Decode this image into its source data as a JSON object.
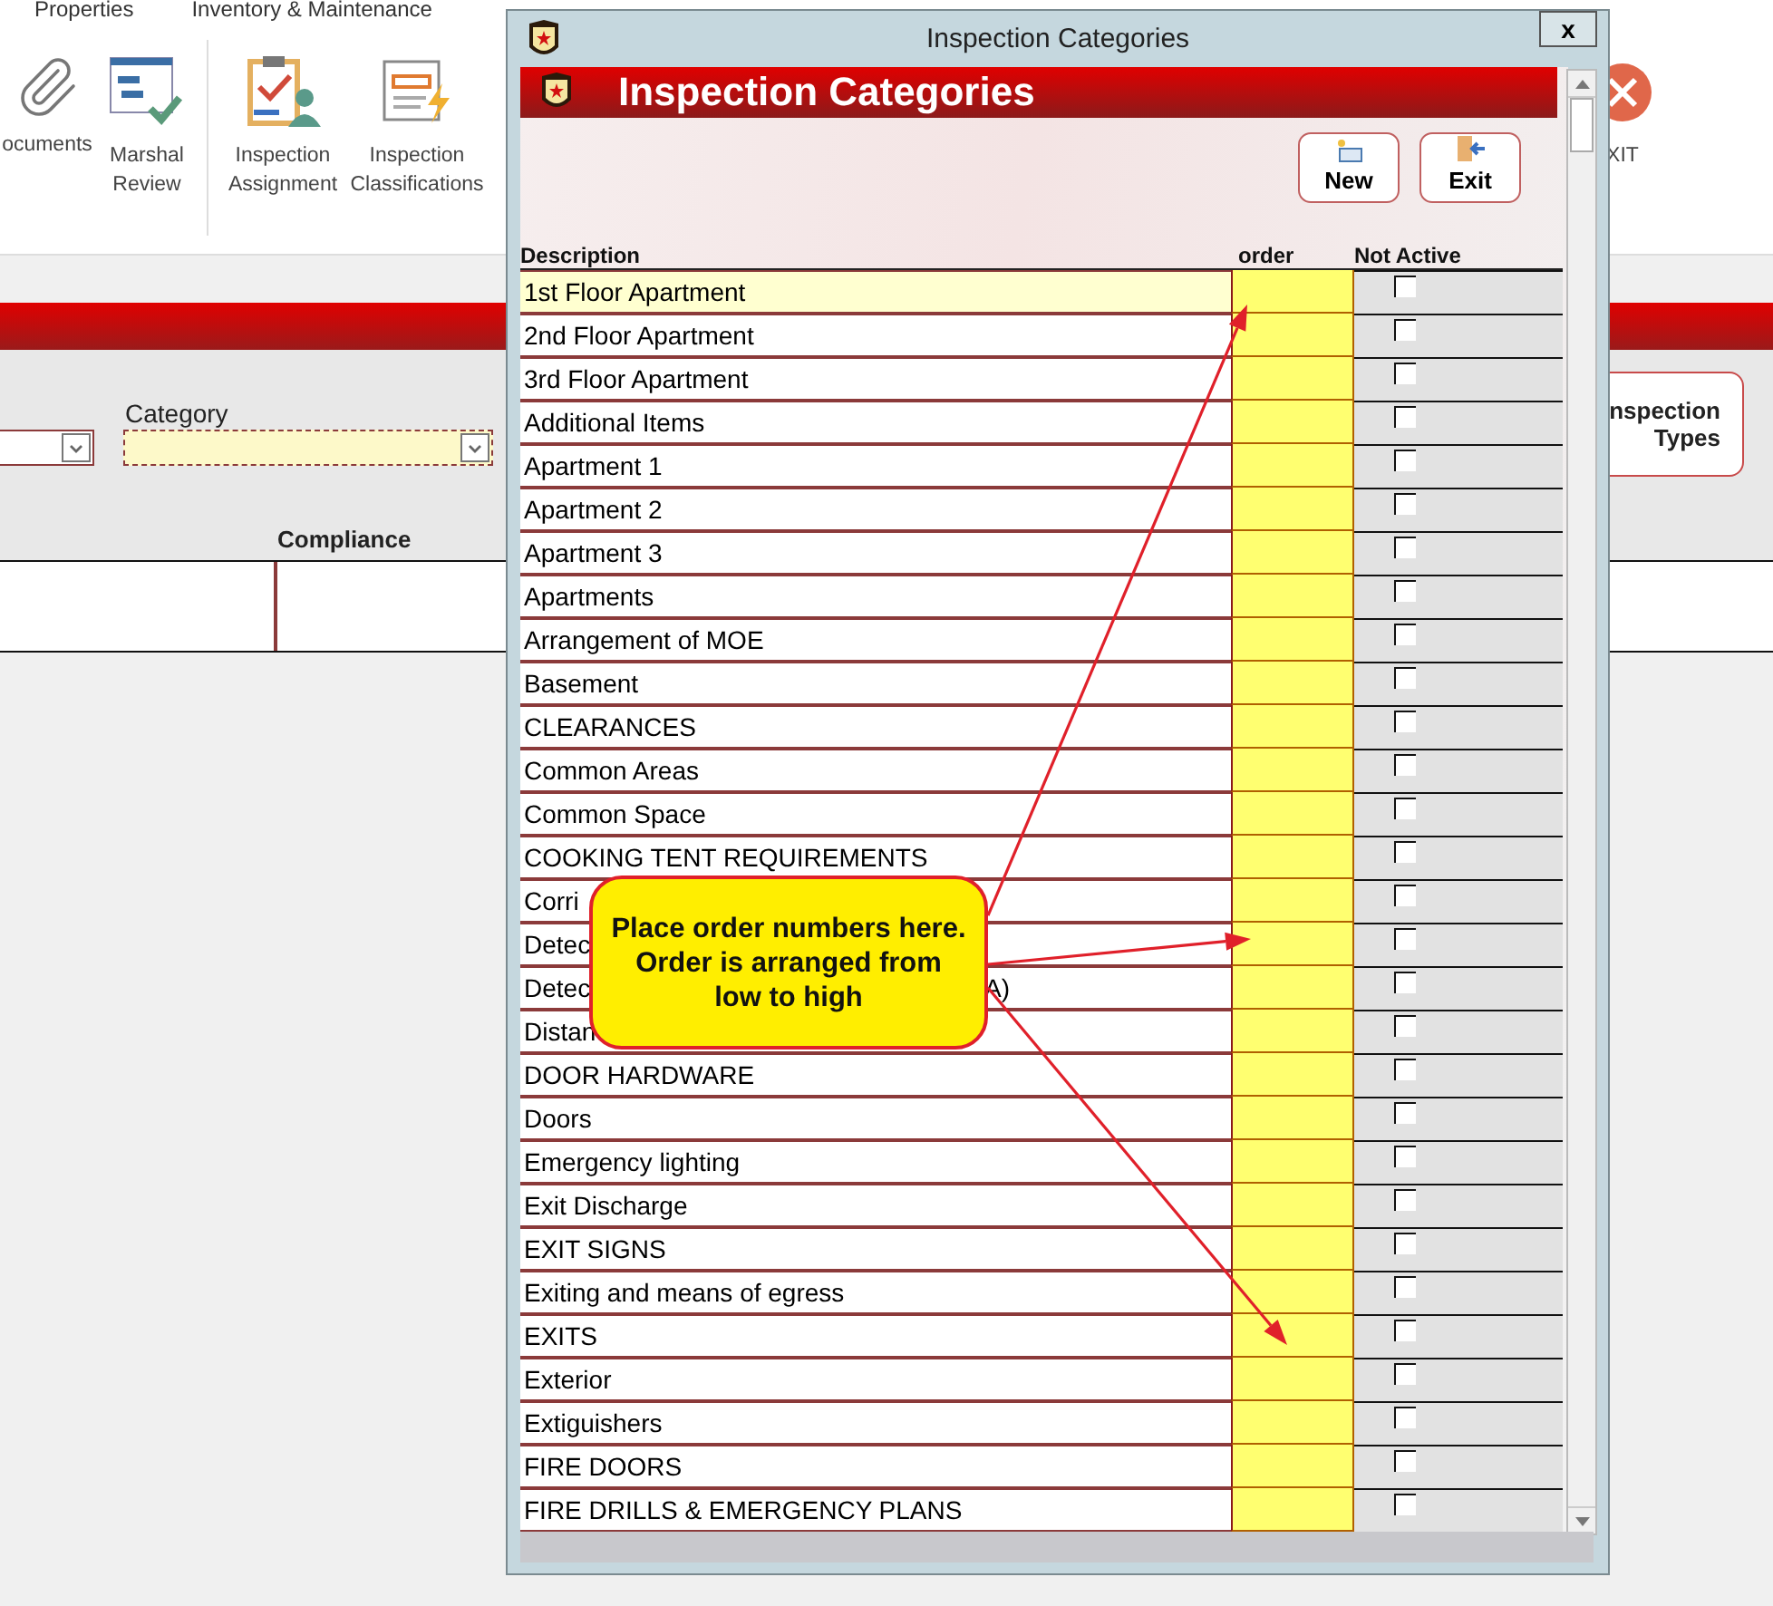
{
  "app": {
    "tabs": [
      "Properties",
      "Inventory & Maintenance"
    ],
    "ribbon": [
      {
        "kind": "clip",
        "label": "ocuments"
      },
      {
        "kind": "grid",
        "label": "Marshal Review"
      },
      {
        "kind": "clipboard",
        "label": "Inspection Assignment"
      },
      {
        "kind": "bolt",
        "label": "Inspection Classifications"
      }
    ],
    "exit_label": "XIT",
    "category_label": "Category",
    "types_button": "nspection Types",
    "column": "Compliance"
  },
  "dialog": {
    "title": "Inspection Categories",
    "close": "x",
    "banner": "Inspection Categories",
    "buttons": [
      {
        "kind": "new",
        "label": "New"
      },
      {
        "kind": "exit",
        "label": "Exit"
      }
    ],
    "columns": [
      "Description",
      "order",
      "Not Active"
    ],
    "rows": [
      {
        "text": "1st Floor Apartment",
        "selected": true,
        "not_active": false
      },
      {
        "text": "2nd Floor Apartment",
        "selected": false,
        "not_active": false
      },
      {
        "text": "3rd Floor Apartment",
        "selected": false,
        "not_active": false
      },
      {
        "text": "Additional Items",
        "selected": false,
        "not_active": false
      },
      {
        "text": "Apartment 1",
        "selected": false,
        "not_active": false
      },
      {
        "text": "Apartment 2",
        "selected": false,
        "not_active": false
      },
      {
        "text": "Apartment 3",
        "selected": false,
        "not_active": false
      },
      {
        "text": "Apartments",
        "selected": false,
        "not_active": false
      },
      {
        "text": "Arrangement of MOE",
        "selected": false,
        "not_active": false
      },
      {
        "text": "Basement",
        "selected": false,
        "not_active": false
      },
      {
        "text": "CLEARANCES",
        "selected": false,
        "not_active": false
      },
      {
        "text": "Common Areas",
        "selected": false,
        "not_active": false
      },
      {
        "text": "Common Space",
        "selected": false,
        "not_active": false
      },
      {
        "text": "COOKING TENT REQUIREMENTS",
        "selected": false,
        "not_active": false
      },
      {
        "text": "Corri",
        "selected": false,
        "not_active": false
      },
      {
        "text": "Detec",
        "selected": false,
        "not_active": false
      },
      {
        "text": "Detec",
        "tail": "A)",
        "selected": false,
        "not_active": false
      },
      {
        "text": "Distan",
        "selected": false,
        "not_active": false
      },
      {
        "text": "DOOR HARDWARE",
        "selected": false,
        "not_active": false
      },
      {
        "text": "Doors",
        "selected": false,
        "not_active": false
      },
      {
        "text": "Emergency lighting",
        "selected": false,
        "not_active": false
      },
      {
        "text": "Exit Discharge",
        "selected": false,
        "not_active": false
      },
      {
        "text": "EXIT SIGNS",
        "selected": false,
        "not_active": false
      },
      {
        "text": "Exiting and means of egress",
        "selected": false,
        "not_active": false
      },
      {
        "text": "EXITS",
        "selected": false,
        "not_active": false
      },
      {
        "text": "Exterior",
        "selected": false,
        "not_active": false
      },
      {
        "text": "Extiguishers",
        "selected": false,
        "not_active": false
      },
      {
        "text": "FIRE DOORS",
        "selected": false,
        "not_active": false
      },
      {
        "text": "FIRE DRILLS & EMERGENCY PLANS",
        "selected": false,
        "not_active": false
      }
    ]
  },
  "callout": {
    "lines": [
      "Place order numbers here.",
      "Order is arranged from",
      "low to high"
    ]
  }
}
